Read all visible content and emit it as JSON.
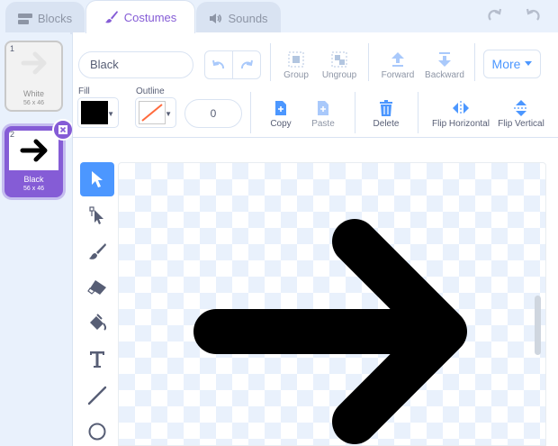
{
  "tabs": [
    {
      "label": "Blocks",
      "icon": "blocks-icon",
      "active": false
    },
    {
      "label": "Costumes",
      "icon": "brush-icon",
      "active": true
    },
    {
      "label": "Sounds",
      "icon": "speaker-icon",
      "active": false
    }
  ],
  "costumes": [
    {
      "number": "1",
      "name": "White",
      "size": "56 x 46",
      "selected": false
    },
    {
      "number": "2",
      "name": "Black",
      "size": "56 x 46",
      "selected": true
    }
  ],
  "editor": {
    "costume_name": "Black",
    "toolbar": {
      "group": "Group",
      "ungroup": "Ungroup",
      "forward": "Forward",
      "backward": "Backward",
      "more": "More",
      "copy": "Copy",
      "paste": "Paste",
      "delete": "Delete",
      "flip_horizontal": "Flip Horizontal",
      "flip_vertical": "Flip Vertical"
    },
    "fill_label": "Fill",
    "outline_label": "Outline",
    "outline_width": "0",
    "fill_color": "#000000",
    "outline_color": "none"
  },
  "tools": [
    "select-tool-icon",
    "reshape-tool-icon",
    "brush-tool-icon",
    "eraser-tool-icon",
    "fill-tool-icon",
    "text-tool-icon",
    "line-tool-icon",
    "circle-tool-icon"
  ],
  "colors": {
    "accent": "#855cd6",
    "blue": "#4c97ff",
    "panel": "#e9f1fc"
  }
}
